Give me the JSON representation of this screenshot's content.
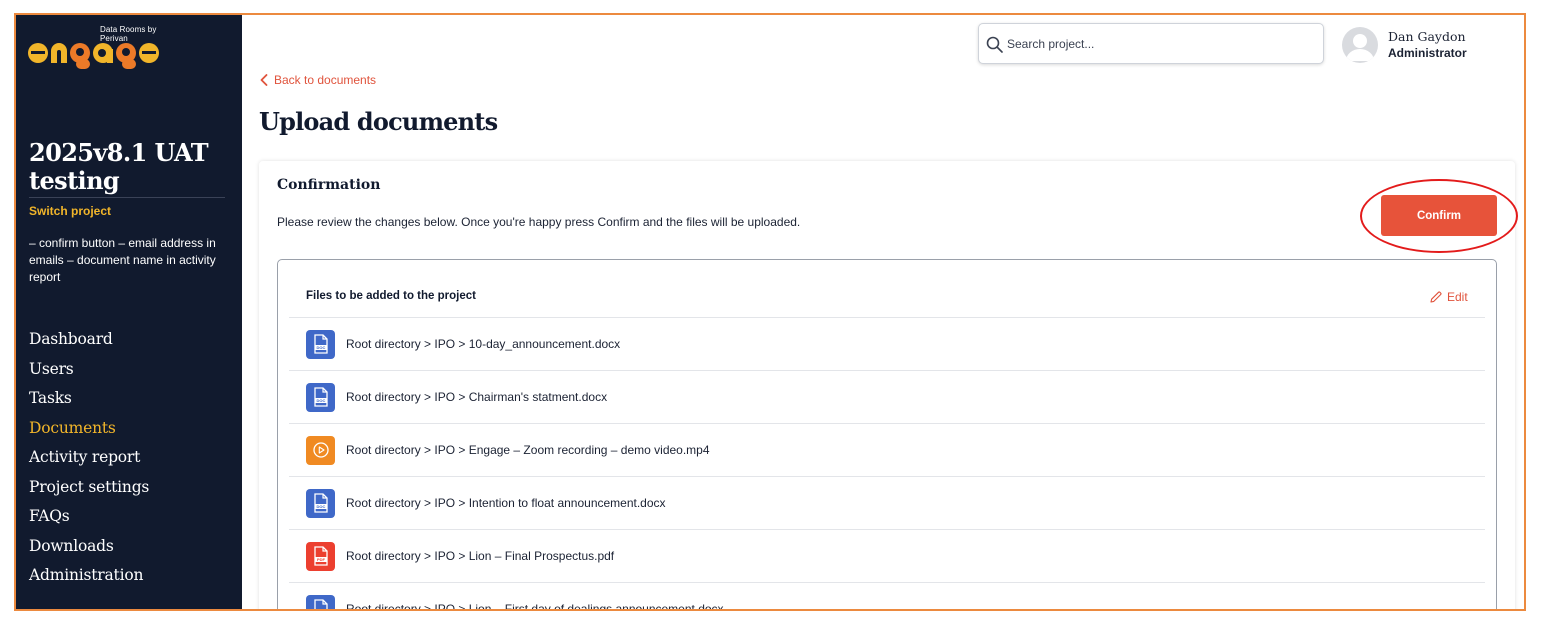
{
  "colors": {
    "sidebar_bg": "#111a2e",
    "accent_orange": "#e7533a",
    "highlight_yellow": "#f1b52a",
    "doc_icon": "#3f68c8",
    "video_icon": "#f08a22",
    "pdf_icon": "#ec3f2f",
    "annotation_red": "#e31b1b"
  },
  "brand": {
    "tagline": "Data Rooms by Perivan",
    "wordmark": "engage"
  },
  "sidebar": {
    "project_title": "2025v8.1 UAT testing",
    "switch_project": "Switch project",
    "project_description": "– confirm button – email address in emails – document name in activity report",
    "nav": [
      {
        "label": "Dashboard",
        "active": false
      },
      {
        "label": "Users",
        "active": false
      },
      {
        "label": "Tasks",
        "active": false
      },
      {
        "label": "Documents",
        "active": true
      },
      {
        "label": "Activity report",
        "active": false
      },
      {
        "label": "Project settings",
        "active": false
      },
      {
        "label": "FAQs",
        "active": false
      },
      {
        "label": "Downloads",
        "active": false
      },
      {
        "label": "Administration",
        "active": false
      }
    ]
  },
  "header": {
    "search_placeholder": "Search project...",
    "user_name": "Dan Gaydon",
    "user_role": "Administrator"
  },
  "main": {
    "back_link": "Back to documents",
    "page_title": "Upload documents",
    "card": {
      "title": "Confirmation",
      "description": "Please review the changes below. Once you're happy press Confirm and the files will be uploaded.",
      "confirm_label": "Confirm",
      "files_header": "Files to be added to the project",
      "edit_label": "Edit",
      "files": [
        {
          "path": "Root directory > IPO > 10-day_announcement.docx",
          "type": "doc",
          "icon": "doc-file-icon"
        },
        {
          "path": "Root directory > IPO > Chairman's statment.docx",
          "type": "doc",
          "icon": "doc-file-icon"
        },
        {
          "path": "Root directory > IPO > Engage – Zoom recording – demo video.mp4",
          "type": "video",
          "icon": "video-file-icon"
        },
        {
          "path": "Root directory > IPO > Intention to float announcement.docx",
          "type": "doc",
          "icon": "doc-file-icon"
        },
        {
          "path": "Root directory > IPO > Lion – Final Prospectus.pdf",
          "type": "pdf",
          "icon": "pdf-file-icon"
        },
        {
          "path": "Root directory > IPO > Lion – First day of dealings announcement.docx",
          "type": "doc",
          "icon": "doc-file-icon"
        }
      ]
    }
  }
}
